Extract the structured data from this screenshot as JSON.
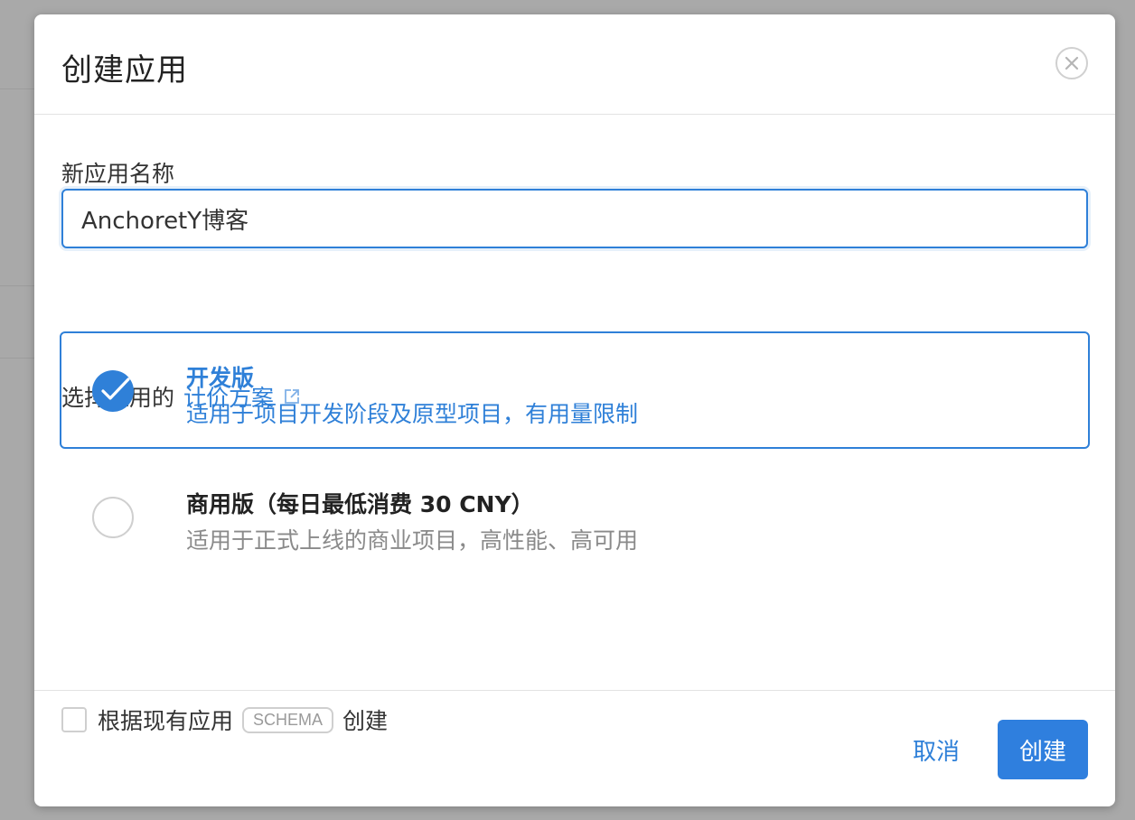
{
  "dialog": {
    "title": "创建应用",
    "close_icon": "close-icon"
  },
  "form": {
    "name_label": "新应用名称",
    "name_value": "AnchoretY博客",
    "plan_label_prefix": "选择应用的",
    "plan_link": "计价方案",
    "plans": [
      {
        "name": "开发版",
        "description": "适用于项目开发阶段及原型项目，有用量限制",
        "selected": true
      },
      {
        "name": "商用版（每日最低消费 30 CNY）",
        "description": "适用于正式上线的商业项目，高性能、高可用",
        "selected": false
      }
    ],
    "schema_option": {
      "prefix": "根据现有应用",
      "badge": "SCHEMA",
      "suffix": "创建",
      "checked": false
    }
  },
  "footer": {
    "cancel_label": "取消",
    "create_label": "创建"
  },
  "colors": {
    "accent": "#2f80d8",
    "primary_button": "#2f7fde",
    "muted_text": "#8a8a8a"
  }
}
